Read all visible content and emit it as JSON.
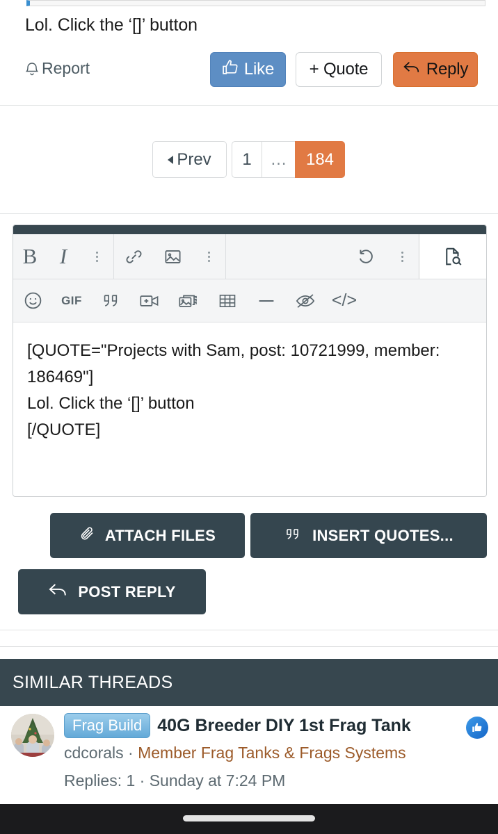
{
  "post": {
    "body_text": "Lol. Click the ‘[]’ button",
    "report_label": "Report",
    "like_label": "Like",
    "quote_label": "+ Quote",
    "reply_label": "Reply"
  },
  "pagination": {
    "prev_label": "Prev",
    "first_page": "1",
    "ellipsis": "…",
    "current_page": "184"
  },
  "editor": {
    "toolbar_row1": [
      {
        "name": "bold-icon",
        "glyph": "B"
      },
      {
        "name": "italic-icon",
        "glyph": "I"
      },
      {
        "name": "more-text-options-icon",
        "glyph": "⋮"
      },
      {
        "name": "link-icon",
        "glyph": "ὑ7"
      },
      {
        "name": "image-icon",
        "glyph": "Ὓc"
      },
      {
        "name": "more-insert-options-icon",
        "glyph": "⋮"
      },
      {
        "name": "undo-icon",
        "glyph": "↺"
      },
      {
        "name": "more-history-options-icon",
        "glyph": "⋮"
      },
      {
        "name": "preview-icon",
        "glyph": "὜b"
      }
    ],
    "toolbar_row2": [
      {
        "name": "emoji-icon",
        "glyph": "☺"
      },
      {
        "name": "gif-icon",
        "glyph": "GIF"
      },
      {
        "name": "quote-icon",
        "glyph": "❝"
      },
      {
        "name": "insert-video-icon",
        "glyph": "὏9"
      },
      {
        "name": "gallery-icon",
        "glyph": "Ὓc"
      },
      {
        "name": "table-icon",
        "glyph": "▦"
      },
      {
        "name": "horizontal-rule-icon",
        "glyph": "—"
      },
      {
        "name": "spoiler-icon",
        "glyph": "ὄ1"
      },
      {
        "name": "code-icon",
        "glyph": "</>"
      }
    ],
    "content": "[QUOTE=\"Projects with Sam, post: 10721999, member: 186469\"]\nLol. Click the ‘[]’ button\n[/QUOTE]"
  },
  "actions": {
    "attach_files": "ATTACH FILES",
    "insert_quotes": "INSERT QUOTES...",
    "post_reply": "POST REPLY"
  },
  "similar_threads": {
    "header": "SIMILAR THREADS",
    "items": [
      {
        "badge": "Frag Build",
        "title": "40G Breeder DIY 1st Frag Tank",
        "author": "cdcorals",
        "separator": " · ",
        "category": "Member Frag Tanks & Frags Systems",
        "meta": "Replies: 1 · Sunday at 7:24 PM"
      }
    ]
  },
  "colors": {
    "accent_orange": "#e17a44",
    "like_blue": "#5d8ec4",
    "dark_slate": "#37474f",
    "category_link": "#9c5b2a",
    "badge_blue": "#63a9d8"
  }
}
